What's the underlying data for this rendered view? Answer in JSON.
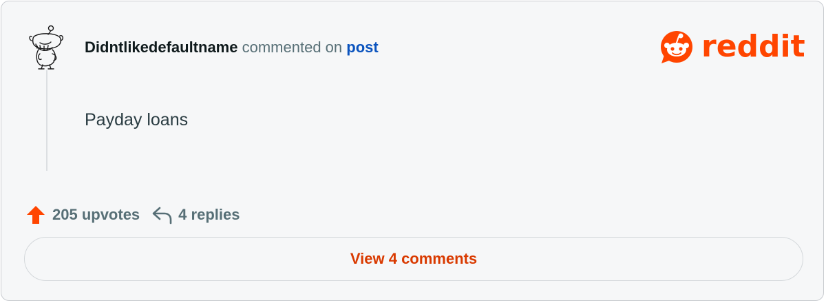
{
  "comment": {
    "username": "Didntlikedefaultname",
    "action_text": "commented on",
    "post_link_label": "post",
    "body": "Payday loans"
  },
  "brand": {
    "logo_text": "reddit",
    "accent_color": "#ff4500"
  },
  "stats": {
    "upvotes_label": "205 upvotes",
    "replies_label": "4 replies",
    "upvote_icon": "upvote-arrow-icon",
    "reply_icon": "reply-arrow-icon"
  },
  "actions": {
    "view_comments_label": "View 4 comments"
  }
}
